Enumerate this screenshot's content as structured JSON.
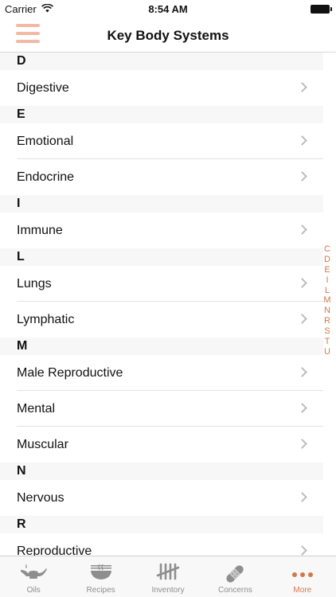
{
  "status_bar": {
    "carrier": "Carrier",
    "time": "8:54 AM"
  },
  "nav": {
    "title": "Key Body Systems"
  },
  "sections": [
    {
      "letter": "D",
      "items": [
        "Digestive"
      ]
    },
    {
      "letter": "E",
      "items": [
        "Emotional",
        "Endocrine"
      ]
    },
    {
      "letter": "I",
      "items": [
        "Immune"
      ]
    },
    {
      "letter": "L",
      "items": [
        "Lungs",
        "Lymphatic"
      ]
    },
    {
      "letter": "M",
      "items": [
        "Male Reproductive",
        "Mental",
        "Muscular"
      ]
    },
    {
      "letter": "N",
      "items": [
        "Nervous"
      ]
    },
    {
      "letter": "R",
      "items": [
        "Reproductive"
      ]
    }
  ],
  "index": [
    "C",
    "D",
    "E",
    "I",
    "L",
    "M",
    "N",
    "R",
    "S",
    "T",
    "U"
  ],
  "tabs": [
    {
      "label": "Oils",
      "icon": "oil-lamp-icon"
    },
    {
      "label": "Recipes",
      "icon": "bowl-icon"
    },
    {
      "label": "Inventory",
      "icon": "tally-icon"
    },
    {
      "label": "Concerns",
      "icon": "bandage-icon"
    },
    {
      "label": "More",
      "icon": "more-icon"
    }
  ],
  "active_tab": "More",
  "colors": {
    "accent": "#d4784a",
    "menu_icon": "#f2b9a4",
    "section_bg": "#f7f7f7",
    "tab_inactive": "#8e8e8e"
  }
}
